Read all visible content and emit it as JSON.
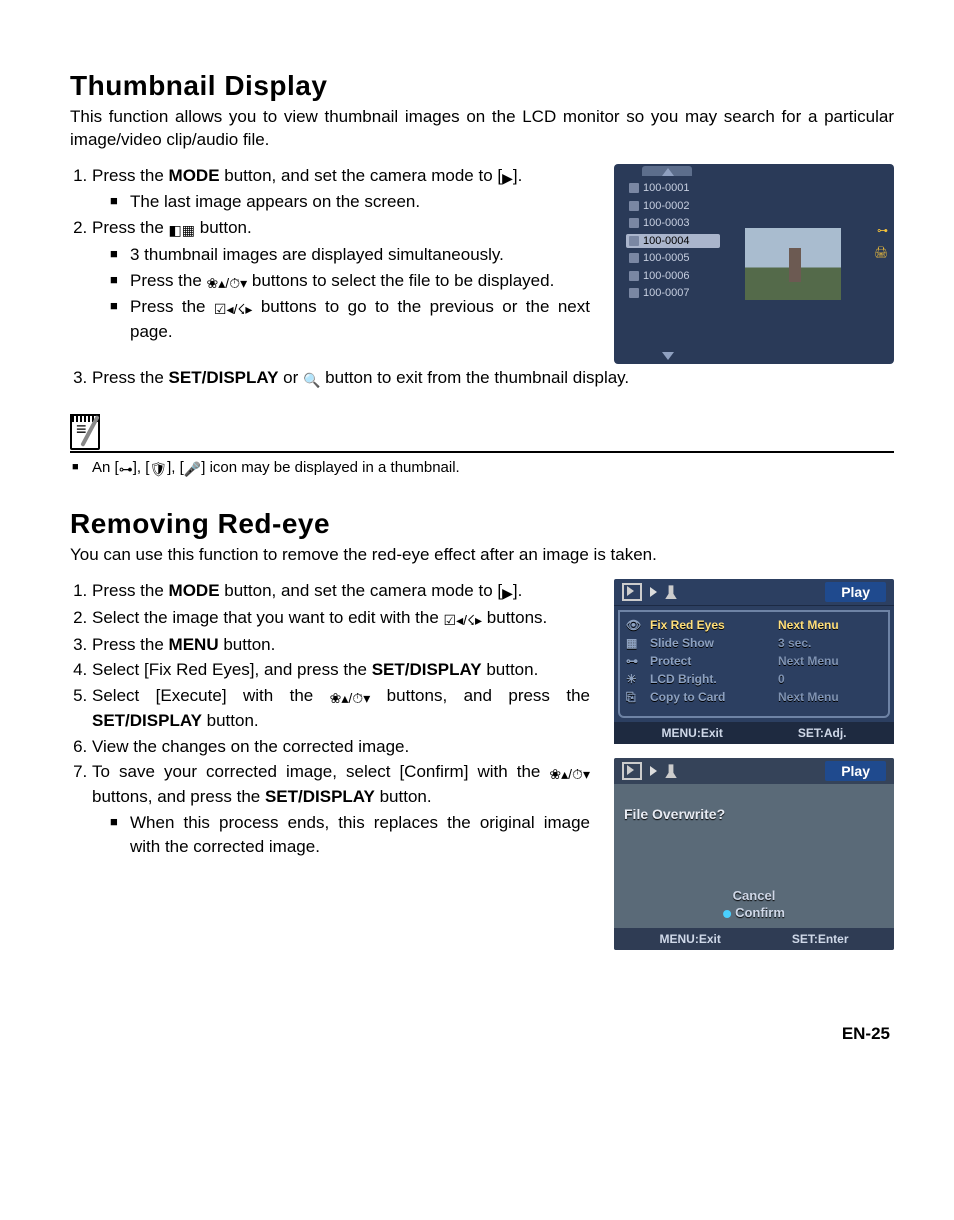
{
  "section1": {
    "title": "Thumbnail Display",
    "intro": "This function allows you to view thumbnail images on the LCD monitor so you may search for a particular image/video clip/audio file.",
    "steps": {
      "s1": "Press the MODE button, and set the camera mode to [▶].",
      "s1a": "The last image appears on the screen.",
      "s2": "Press the ◧▦ button.",
      "s2a": "3 thumbnail images are displayed simultaneously.",
      "s2b": "Press the ❀▴/⏱▾ buttons to select the file to be displayed.",
      "s2c": "Press the ☑◂/☇▸ buttons to go to the previous or the next page.",
      "s3": "Press the SET/DISPLAY or 🔍 button to exit from the thumbnail display."
    },
    "note": "An [⊶], [🛡], [🎤] icon may be displayed in a thumbnail.",
    "lcd": {
      "files": [
        "100-0001",
        "100-0002",
        "100-0003",
        "100-0004",
        "100-0005",
        "100-0006",
        "100-0007"
      ],
      "badge1": "⊶",
      "badge2": "🖨"
    }
  },
  "section2": {
    "title": "Removing Red-eye",
    "intro": "You can use this function to remove the red-eye effect after an image is taken.",
    "steps": {
      "s1": "Press the MODE button, and set the camera mode to [▶].",
      "s2": "Select the image that you want to edit with the ☑◂/☇▸ buttons.",
      "s3": "Press the MENU button.",
      "s4": "Select [Fix Red Eyes], and press the SET/DISPLAY button.",
      "s5": "Select [Execute] with the ❀▴/⏱▾ buttons, and press the SET/DISPLAY button.",
      "s6": "View the changes on the corrected image.",
      "s7": "To save your corrected image, select [Confirm] with the ❀▴/⏱▾ buttons, and press the SET/DISPLAY button.",
      "s7a": "When this process ends, this replaces the original image with the corrected image."
    },
    "lcd2": {
      "title": "Play",
      "rows": [
        {
          "label": "Fix Red Eyes",
          "value": "Next Menu"
        },
        {
          "label": "Slide Show",
          "value": "3 sec."
        },
        {
          "label": "Protect",
          "value": "Next Menu"
        },
        {
          "label": "LCD Bright.",
          "value": "0"
        },
        {
          "label": "Copy to Card",
          "value": "Next Menu"
        }
      ],
      "footerL": "MENU:Exit",
      "footerR": "SET:Adj."
    },
    "lcd3": {
      "title": "Play",
      "prompt": "File Overwrite?",
      "opt1": "Cancel",
      "opt2": "Confirm",
      "footerL": "MENU:Exit",
      "footerR": "SET:Enter"
    }
  },
  "pageNum": "EN-25"
}
